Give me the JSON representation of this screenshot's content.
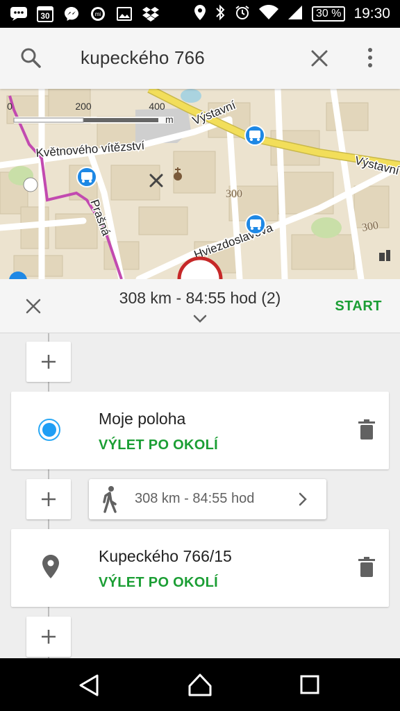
{
  "status_bar": {
    "calendar_day": "30",
    "battery": "30 %",
    "time": "19:30",
    "icons": [
      "chat-icon",
      "calendar-icon",
      "messenger-icon",
      "mi-icon",
      "image-icon",
      "dropbox-icon",
      "location-icon",
      "bluetooth-icon",
      "alarm-icon",
      "wifi-icon",
      "signal-icon",
      "battery-icon"
    ]
  },
  "search": {
    "query": "kupeckého 766",
    "icons": [
      "search-icon",
      "close-icon",
      "more-vert-icon"
    ]
  },
  "map": {
    "scale_labels": [
      "0",
      "200",
      "400"
    ],
    "scale_unit": "m",
    "street_labels": [
      "Výstavní",
      "Výstavní",
      "Květnového vítězství",
      "Prašná",
      "Hviezdoslavova"
    ],
    "elevation_labels": [
      "300",
      "300"
    ],
    "road_color": "#f2de5a",
    "tram_color": "#c24ab0",
    "bus_stop_color": "#1e88e5"
  },
  "route": {
    "summary": "308 km - 84:55 hod (2)",
    "start_label": "START",
    "waypoints": [
      {
        "title": "Moje poloha",
        "subtitle": "VÝLET PO OKOLÍ",
        "icon": "my-location-icon"
      },
      {
        "title": "Kupeckého 766/15",
        "subtitle": "VÝLET PO OKOLÍ",
        "icon": "place-icon"
      }
    ],
    "leg": {
      "text": "308 km - 84:55 hod",
      "icon": "walk-icon"
    },
    "accent_color": "#1b9e34"
  },
  "nav_bar": {
    "icons": [
      "back-icon",
      "home-icon",
      "recents-icon"
    ]
  }
}
